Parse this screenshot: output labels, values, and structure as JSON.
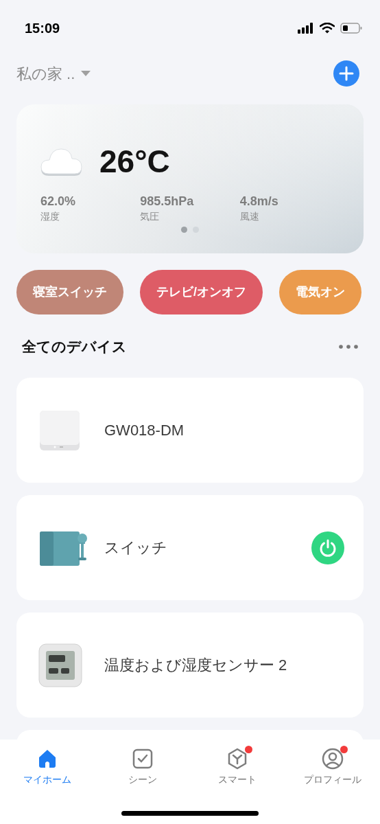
{
  "status_bar": {
    "time": "15:09"
  },
  "header": {
    "home_name": "私の家 .."
  },
  "weather": {
    "temperature": "26°C",
    "stats": [
      {
        "value": "62.0%",
        "label": "湿度"
      },
      {
        "value": "985.5hPa",
        "label": "気圧"
      },
      {
        "value": "4.8m/s",
        "label": "風速"
      }
    ],
    "pages": [
      {
        "selected": true
      },
      {
        "selected": false
      }
    ]
  },
  "scenes": [
    {
      "label": "寝室スイッチ",
      "color": "#c08677"
    },
    {
      "label": "テレビ/オンオフ",
      "color": "#de5c66"
    },
    {
      "label": "電気オン",
      "color": "#eb9b4d"
    }
  ],
  "section": {
    "title": "全てのデバイス"
  },
  "devices": [
    {
      "kind": "hub",
      "name": "GW018-DM"
    },
    {
      "kind": "plug",
      "name": "スイッチ",
      "on": true
    },
    {
      "kind": "sensor",
      "name": "温度および湿度センサー 2"
    }
  ],
  "tab_bar": [
    {
      "kind": "home",
      "label": "マイホーム",
      "selected": true,
      "notification": false
    },
    {
      "kind": "scene",
      "label": "シーン",
      "selected": false,
      "notification": false
    },
    {
      "kind": "smart",
      "label": "スマート",
      "selected": false,
      "notification": true
    },
    {
      "kind": "profile",
      "label": "プロフィール",
      "selected": false,
      "notification": true
    }
  ]
}
